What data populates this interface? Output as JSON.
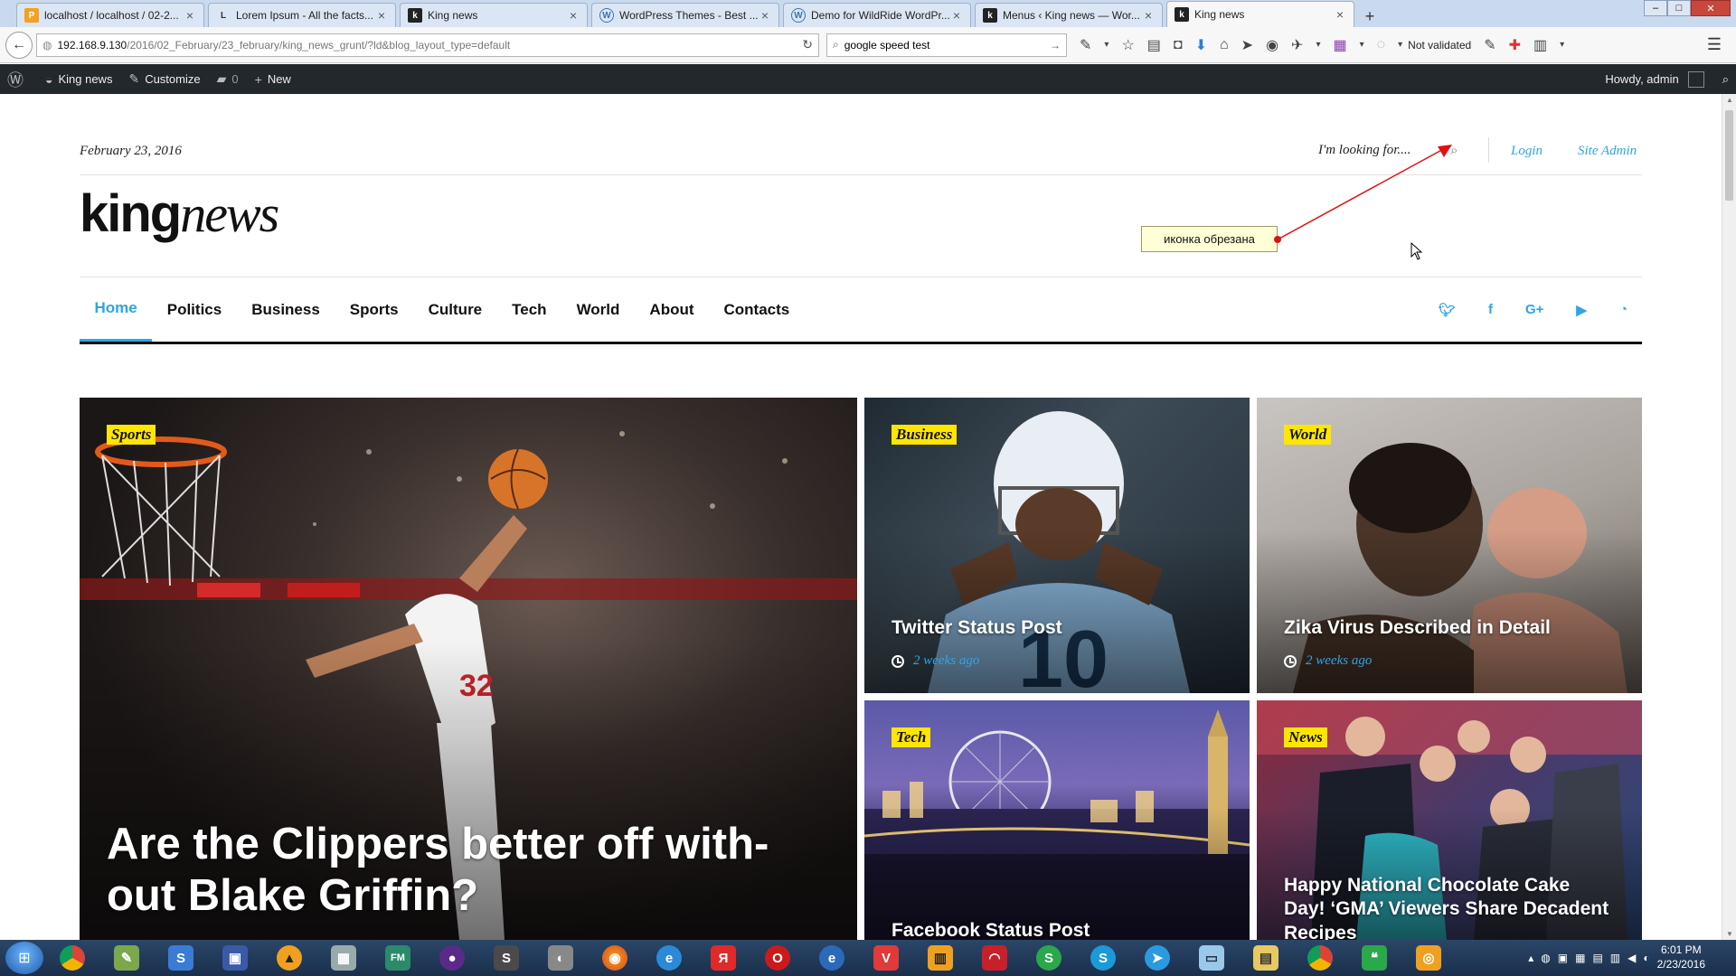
{
  "browser": {
    "tabs": [
      {
        "title": "localhost / localhost / 02-2...",
        "active": false
      },
      {
        "title": "Lorem Ipsum - All the facts...",
        "active": false
      },
      {
        "title": "King news",
        "active": false
      },
      {
        "title": "WordPress Themes - Best ...",
        "active": false
      },
      {
        "title": "Demo for WildRide WordPr...",
        "active": false
      },
      {
        "title": "Menus ‹ King news — Wor...",
        "active": false
      },
      {
        "title": "King news",
        "active": true
      }
    ],
    "url_host": "192.168.9.130",
    "url_path": "/2016/02_February/23_february/king_news_grunt/?ld&blog_layout_type=default",
    "search_value": "google speed test",
    "not_validated": "Not validated"
  },
  "adminbar": {
    "site_name": "King news",
    "customize": "Customize",
    "comments_count": "0",
    "new_label": "New",
    "howdy": "Howdy, admin"
  },
  "header": {
    "date": "February 23, 2016",
    "search_placeholder": "I'm looking for....",
    "login": "Login",
    "site_admin": "Site Admin",
    "logo_bold": "king",
    "logo_italic": "news"
  },
  "annotation": {
    "note": "иконка обрезана"
  },
  "nav": {
    "items": [
      "Home",
      "Politics",
      "Business",
      "Sports",
      "Culture",
      "Tech",
      "World",
      "About",
      "Contacts"
    ],
    "social": [
      "twitter-icon",
      "facebook-icon",
      "google-plus-icon",
      "youtube-icon",
      "rss-icon"
    ]
  },
  "posts": [
    {
      "category": "Sports",
      "title": "Are the Clippers better off with-out Blake Griffin?",
      "meta": ""
    },
    {
      "category": "Business",
      "title": "Twitter Status Post",
      "meta": "2 weeks ago"
    },
    {
      "category": "World",
      "title": "Zika Virus Described in Detail",
      "meta": "2 weeks ago"
    },
    {
      "category": "Tech",
      "title": "Facebook Status Post",
      "meta": ""
    },
    {
      "category": "News",
      "title": "Happy National Chocolate Cake Day! ‘GMA’ Viewers Share Decadent Recipes",
      "meta": ""
    }
  ],
  "taskbar": {
    "time": "6:01 PM",
    "date": "2/23/2016"
  },
  "colors": {
    "accent": "#2fa4e7",
    "category_badge": "#ffe600",
    "admin_bar": "#23282d"
  }
}
